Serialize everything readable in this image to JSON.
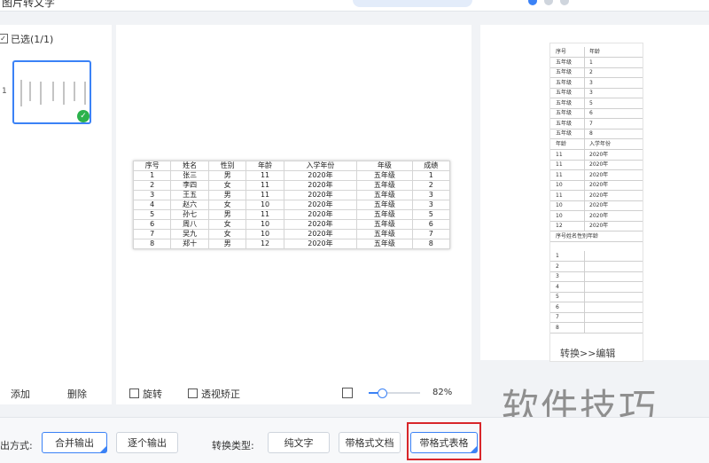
{
  "app": {
    "title": "图片转文字"
  },
  "left": {
    "select_all": "已选(1/1)",
    "thumb_index": "1"
  },
  "toolbar": {
    "add": "添加",
    "delete": "删除",
    "rotate": "旋转",
    "perspective": "透视矫正",
    "zoom": "82%"
  },
  "table": {
    "headers": [
      "序号",
      "姓名",
      "性别",
      "年龄",
      "入学年份",
      "年级",
      "成绩"
    ],
    "rows": [
      [
        "1",
        "张三",
        "男",
        "11",
        "2020年",
        "五年级",
        "1"
      ],
      [
        "2",
        "李四",
        "女",
        "11",
        "2020年",
        "五年级",
        "2"
      ],
      [
        "3",
        "王五",
        "男",
        "11",
        "2020年",
        "五年级",
        "3"
      ],
      [
        "4",
        "赵六",
        "女",
        "10",
        "2020年",
        "五年级",
        "3"
      ],
      [
        "5",
        "孙七",
        "男",
        "11",
        "2020年",
        "五年级",
        "5"
      ],
      [
        "6",
        "周八",
        "女",
        "10",
        "2020年",
        "五年级",
        "6"
      ],
      [
        "7",
        "吴九",
        "女",
        "10",
        "2020年",
        "五年级",
        "7"
      ],
      [
        "8",
        "郑十",
        "男",
        "12",
        "2020年",
        "五年级",
        "8"
      ]
    ]
  },
  "right": {
    "top_rows": [
      [
        "序号",
        "年龄"
      ],
      [
        "五年级",
        "1"
      ],
      [
        "五年级",
        "2"
      ],
      [
        "五年级",
        "3"
      ],
      [
        "五年级",
        "3"
      ],
      [
        "五年级",
        "5"
      ],
      [
        "五年级",
        "6"
      ],
      [
        "五年级",
        "7"
      ],
      [
        "五年级",
        "8"
      ]
    ],
    "mid_rows": [
      [
        "年龄",
        "入学年份"
      ],
      [
        "11",
        "2020年"
      ],
      [
        "11",
        "2020年"
      ],
      [
        "11",
        "2020年"
      ],
      [
        "10",
        "2020年"
      ],
      [
        "11",
        "2020年"
      ],
      [
        "10",
        "2020年"
      ],
      [
        "10",
        "2020年"
      ],
      [
        "12",
        "2020年"
      ]
    ],
    "section_label": "序号姓名性别年龄",
    "low_rows": [
      "1",
      "2",
      "3",
      "4",
      "5",
      "6",
      "7",
      "8"
    ],
    "footer": "转换>>编辑"
  },
  "output": {
    "mode_label": "出方式:",
    "merge": "合并输出",
    "each": "逐个输出",
    "type_label": "转换类型:",
    "plain": "纯文字",
    "doc": "带格式文档",
    "table": "带格式表格"
  },
  "watermark": "软件技巧"
}
